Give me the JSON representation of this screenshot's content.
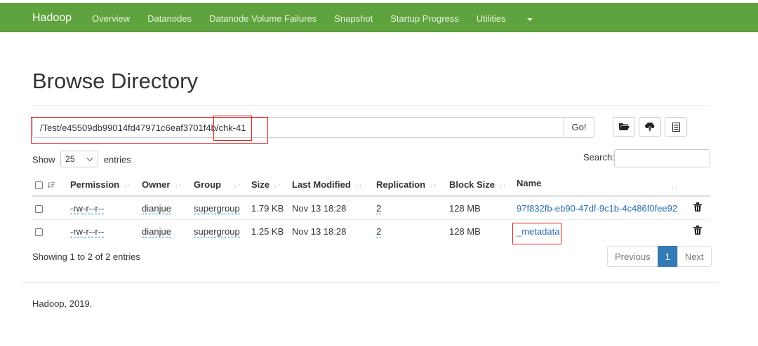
{
  "nav": {
    "brand": "Hadoop",
    "links": [
      "Overview",
      "Datanodes",
      "Datanode Volume Failures",
      "Snapshot",
      "Startup Progress",
      "Utilities"
    ]
  },
  "page": {
    "title": "Browse Directory"
  },
  "directory": {
    "path": "/Test/e45509db99014fd47971c6eaf3701f4b/chk-41",
    "go_label": "Go!"
  },
  "toolbar_icons": [
    "folder-icon",
    "upload-icon",
    "list-icon"
  ],
  "entries": {
    "show_label": "Show",
    "page_size": "25",
    "suffix_label": "entries",
    "search_label": "Search:",
    "search_value": ""
  },
  "table": {
    "headers": [
      "Permission",
      "Owner",
      "Group",
      "Size",
      "Last Modified",
      "Replication",
      "Block Size",
      "Name"
    ],
    "rows": [
      {
        "permission": "-rw-r--r--",
        "owner": "dianjue",
        "group": "supergroup",
        "size": "1.79 KB",
        "modified": "Nov 13 18:28",
        "replication": "2",
        "block_size": "128 MB",
        "name": "97f832fb-eb90-47df-9c1b-4c486f0fee92"
      },
      {
        "permission": "-rw-r--r--",
        "owner": "dianjue",
        "group": "supergroup",
        "size": "1.25 KB",
        "modified": "Nov 13 18:28",
        "replication": "2",
        "block_size": "128 MB",
        "name": "_metadata"
      }
    ]
  },
  "pagination": {
    "info": "Showing 1 to 2 of 2 entries",
    "previous": "Previous",
    "current": "1",
    "next": "Next"
  },
  "footer": {
    "text": "Hadoop, 2019."
  },
  "colors": {
    "navbar": "#5fa33e",
    "link": "#2a6db0",
    "active_page": "#337ab7",
    "highlight": "#e02020"
  }
}
